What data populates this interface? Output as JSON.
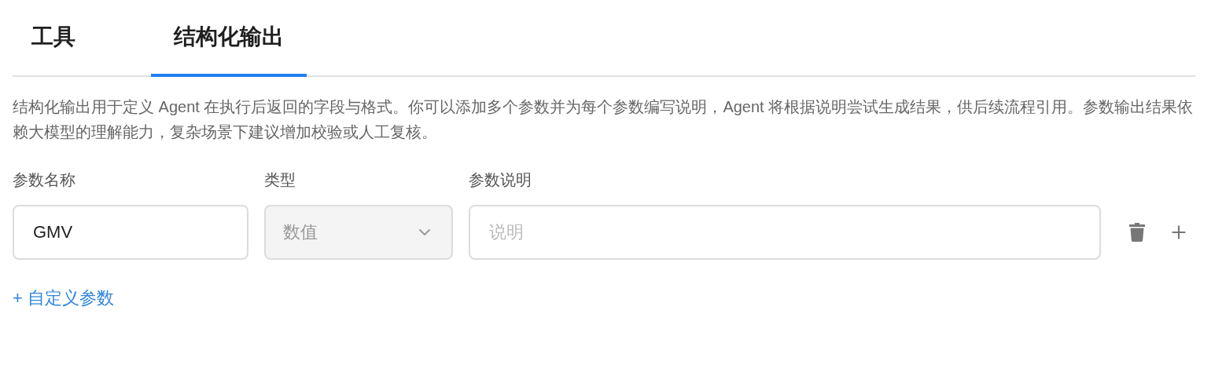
{
  "tabs": [
    {
      "label": "工具",
      "selected": false
    },
    {
      "label": "结构化输出",
      "selected": true
    }
  ],
  "description": "结构化输出用于定义 Agent 在执行后返回的字段与格式。你可以添加多个参数并为每个参数编写说明，Agent 将根据说明尝试生成结果，供后续流程引用。参数输出结果依赖大模型的理解能力，复杂场景下建议增加校验或人工复核。",
  "columns": [
    "参数名称",
    "类型",
    "参数说明"
  ],
  "params": [
    {
      "name": "GMV",
      "type": "数值",
      "type_disabled": true,
      "description_placeholder": "说明"
    }
  ],
  "add_link": "+ 自定义参数"
}
